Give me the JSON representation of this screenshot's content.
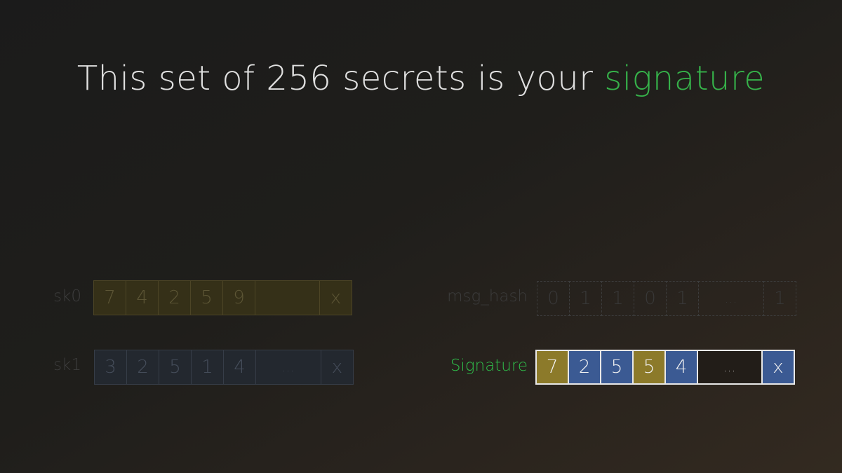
{
  "title": {
    "prefix": "This set of 256 secrets is your ",
    "highlight": "signature"
  },
  "rows": {
    "sk0": {
      "label": "sk0",
      "cells": [
        "7",
        "4",
        "2",
        "5",
        "9",
        "",
        "x"
      ]
    },
    "sk1": {
      "label": "sk1",
      "cells": [
        "3",
        "2",
        "5",
        "1",
        "4",
        "...",
        "x"
      ]
    },
    "msg_hash": {
      "label": "msg_hash",
      "cells": [
        "0",
        "1",
        "1",
        "0",
        "1",
        "...",
        "1"
      ]
    },
    "signature": {
      "label": "Signature",
      "cells": [
        "7",
        "2",
        "5",
        "5",
        "4",
        "...",
        "x"
      ]
    }
  },
  "colors": {
    "accent_green": "#36b24a",
    "sk0_gold": "#8c7a2a",
    "sk1_blue": "#3b5a93"
  }
}
